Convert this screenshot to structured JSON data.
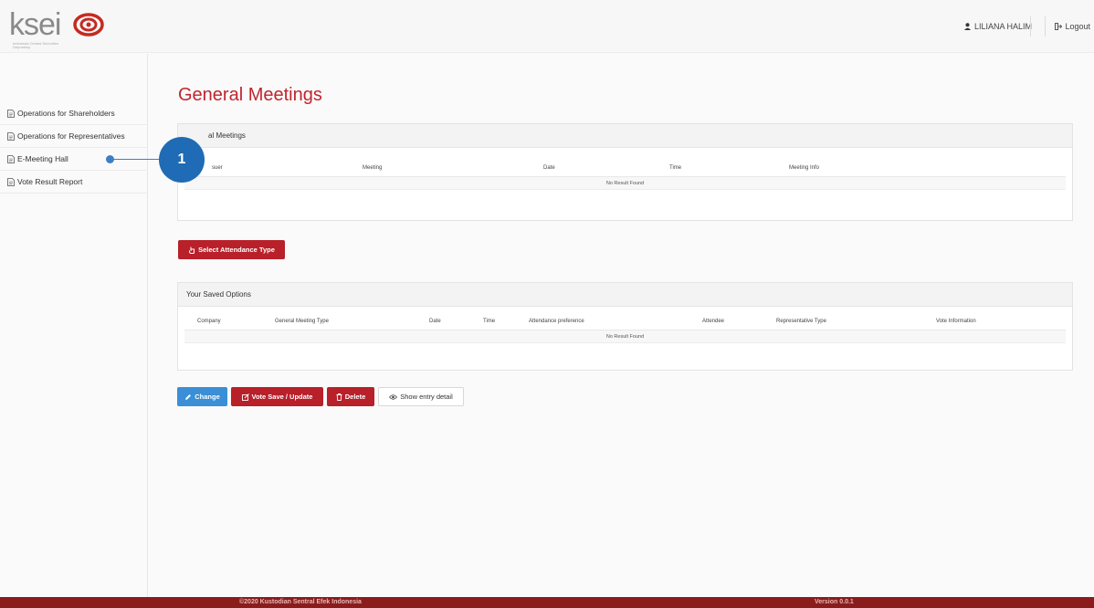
{
  "header": {
    "logo_text": "ksei",
    "logo_subtext": "Indonesia Central Securities Depository",
    "user_name": "LILIANA HALIM",
    "logout_label": "Logout"
  },
  "sidebar": {
    "items": [
      {
        "label": "Operations for Shareholders"
      },
      {
        "label": "Operations for Representatives"
      },
      {
        "label": "E-Meeting Hall"
      },
      {
        "label": "Vote Result Report"
      }
    ]
  },
  "annotation": {
    "number": "1"
  },
  "main": {
    "title": "General Meetings",
    "meetings_panel": {
      "title": "al Meetings",
      "columns": [
        "suer",
        "Meeting",
        "Date",
        "Time",
        "Meeting Info"
      ],
      "empty_text": "No Result Found"
    },
    "select_attendance_button": "Select Attendance Type",
    "saved_panel": {
      "title": "Your Saved Options",
      "columns": [
        "Company",
        "General Meeting Type",
        "Date",
        "Time",
        "Attendance preference",
        "Attendee",
        "Representative Type",
        "Vote Information"
      ],
      "empty_text": "No Result Found"
    },
    "actions": {
      "change": "Change",
      "vote_save": "Vote Save / Update",
      "delete": "Delete",
      "show_detail": "Show entry detail"
    }
  },
  "footer": {
    "copyright": "©2020 Kustodian Sentral Efek Indonesia",
    "version": "Version 0.0.1"
  },
  "colors": {
    "brand_red": "#c0262d",
    "button_red": "#b8202a",
    "button_blue": "#3a8fd6",
    "annotation_blue": "#1f6bb6",
    "footer_red": "#8b1c1c"
  }
}
